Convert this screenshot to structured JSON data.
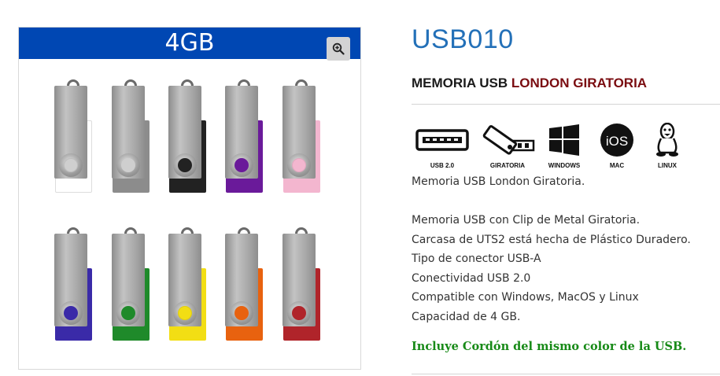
{
  "gallery": {
    "banner": "4GB",
    "zoom_icon": "zoom-in-icon",
    "sticks": [
      {
        "color": "#ffffff",
        "name": "white"
      },
      {
        "color": "#8c8c8c",
        "name": "grey"
      },
      {
        "color": "#222222",
        "name": "black"
      },
      {
        "color": "#6a1a9a",
        "name": "purple"
      },
      {
        "color": "#f3b6cf",
        "name": "pink"
      },
      {
        "color": "#3a2aa8",
        "name": "blue"
      },
      {
        "color": "#1f8a2a",
        "name": "green"
      },
      {
        "color": "#f2de14",
        "name": "yellow"
      },
      {
        "color": "#e8620f",
        "name": "orange"
      },
      {
        "color": "#b0242a",
        "name": "red"
      }
    ]
  },
  "product": {
    "code": "USB010",
    "subtitle_prefix": "MEMORIA USB ",
    "subtitle_accent": "LONDON GIRATORIA"
  },
  "features": [
    {
      "label": "USB 2.0",
      "icon": "usb-port-icon"
    },
    {
      "label": "GIRATORIA",
      "icon": "swivel-usb-icon"
    },
    {
      "label": "WINDOWS",
      "icon": "windows-icon"
    },
    {
      "label": "MAC",
      "icon": "ios-icon"
    },
    {
      "label": "LINUX",
      "icon": "linux-icon"
    }
  ],
  "description": {
    "intro": "Memoria USB London Giratoria.",
    "lines": [
      "Memoria USB con Clip de Metal Giratoria.",
      "Carcasa de UTS2 está hecha de Plástico Duradero.",
      "Tipo de conector USB-A",
      "Conectividad USB 2.0",
      "Compatible con Windows, MacOS y Linux",
      "Capacidad de 4 GB."
    ],
    "cord_note": "Incluye Cordón del mismo color de la USB."
  },
  "colors": {
    "banner_bg": "#0047b3",
    "title": "#2370b8",
    "accent": "#7a0c10",
    "cord_note": "#178a17"
  }
}
